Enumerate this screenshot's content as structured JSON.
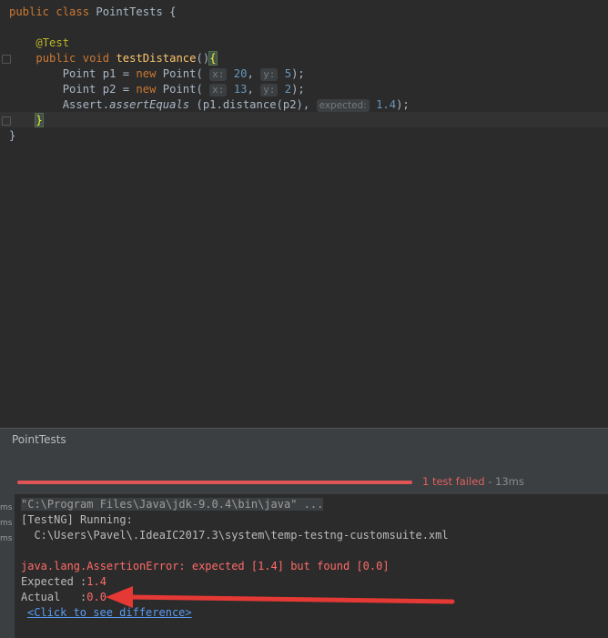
{
  "editor": {
    "class_line": {
      "kw1": "public",
      "kw2": "class",
      "name": "PointTests",
      "brace": "{"
    },
    "annotation": "@Test",
    "method_line": {
      "kw1": "public",
      "kw2": "void",
      "name": "testDistance",
      "parens": "()",
      "brace": "{"
    },
    "p1_line": {
      "type": "Point p1 = ",
      "kw": "new",
      "ctor": " Point(",
      "hint_x": "x:",
      "x": "20",
      "sep": ",",
      "hint_y": "y:",
      "y": "5",
      "end": ");"
    },
    "p2_line": {
      "type": "Point p2 = ",
      "kw": "new",
      "ctor": " Point(",
      "hint_x": "x:",
      "x": "13",
      "sep": ",",
      "hint_y": "y:",
      "y": "2",
      "end": ");"
    },
    "assert_line": {
      "recv": "Assert.",
      "method": "assertEquals",
      "args": " (p1.distance(p2),",
      "hint": "expected:",
      "value": "1.4",
      "end": ");"
    },
    "method_close": "}",
    "class_close": "}"
  },
  "tab": {
    "label": "PointTests"
  },
  "run": {
    "status": "1 test failed",
    "duration": " - 13ms",
    "ms_labels": [
      "ms",
      "ms",
      "ms"
    ],
    "console": {
      "cmd": "\"C:\\Program Files\\Java\\jdk-9.0.4\\bin\\java\" ...",
      "running": "[TestNG] Running:",
      "path": "  C:\\Users\\Pavel\\.IdeaIC2017.3\\system\\temp-testng-customsuite.xml",
      "error": "java.lang.AssertionError: expected [1.4] but found [0.0]",
      "expected_label": "Expected :",
      "expected_value": "1.4",
      "actual_label": "Actual   :",
      "actual_value": "0.0",
      "diff_link": "<Click to see difference>"
    }
  },
  "colors": {
    "arrow": "#e53935",
    "error": "#ff6b68",
    "progress": "#e05555"
  }
}
